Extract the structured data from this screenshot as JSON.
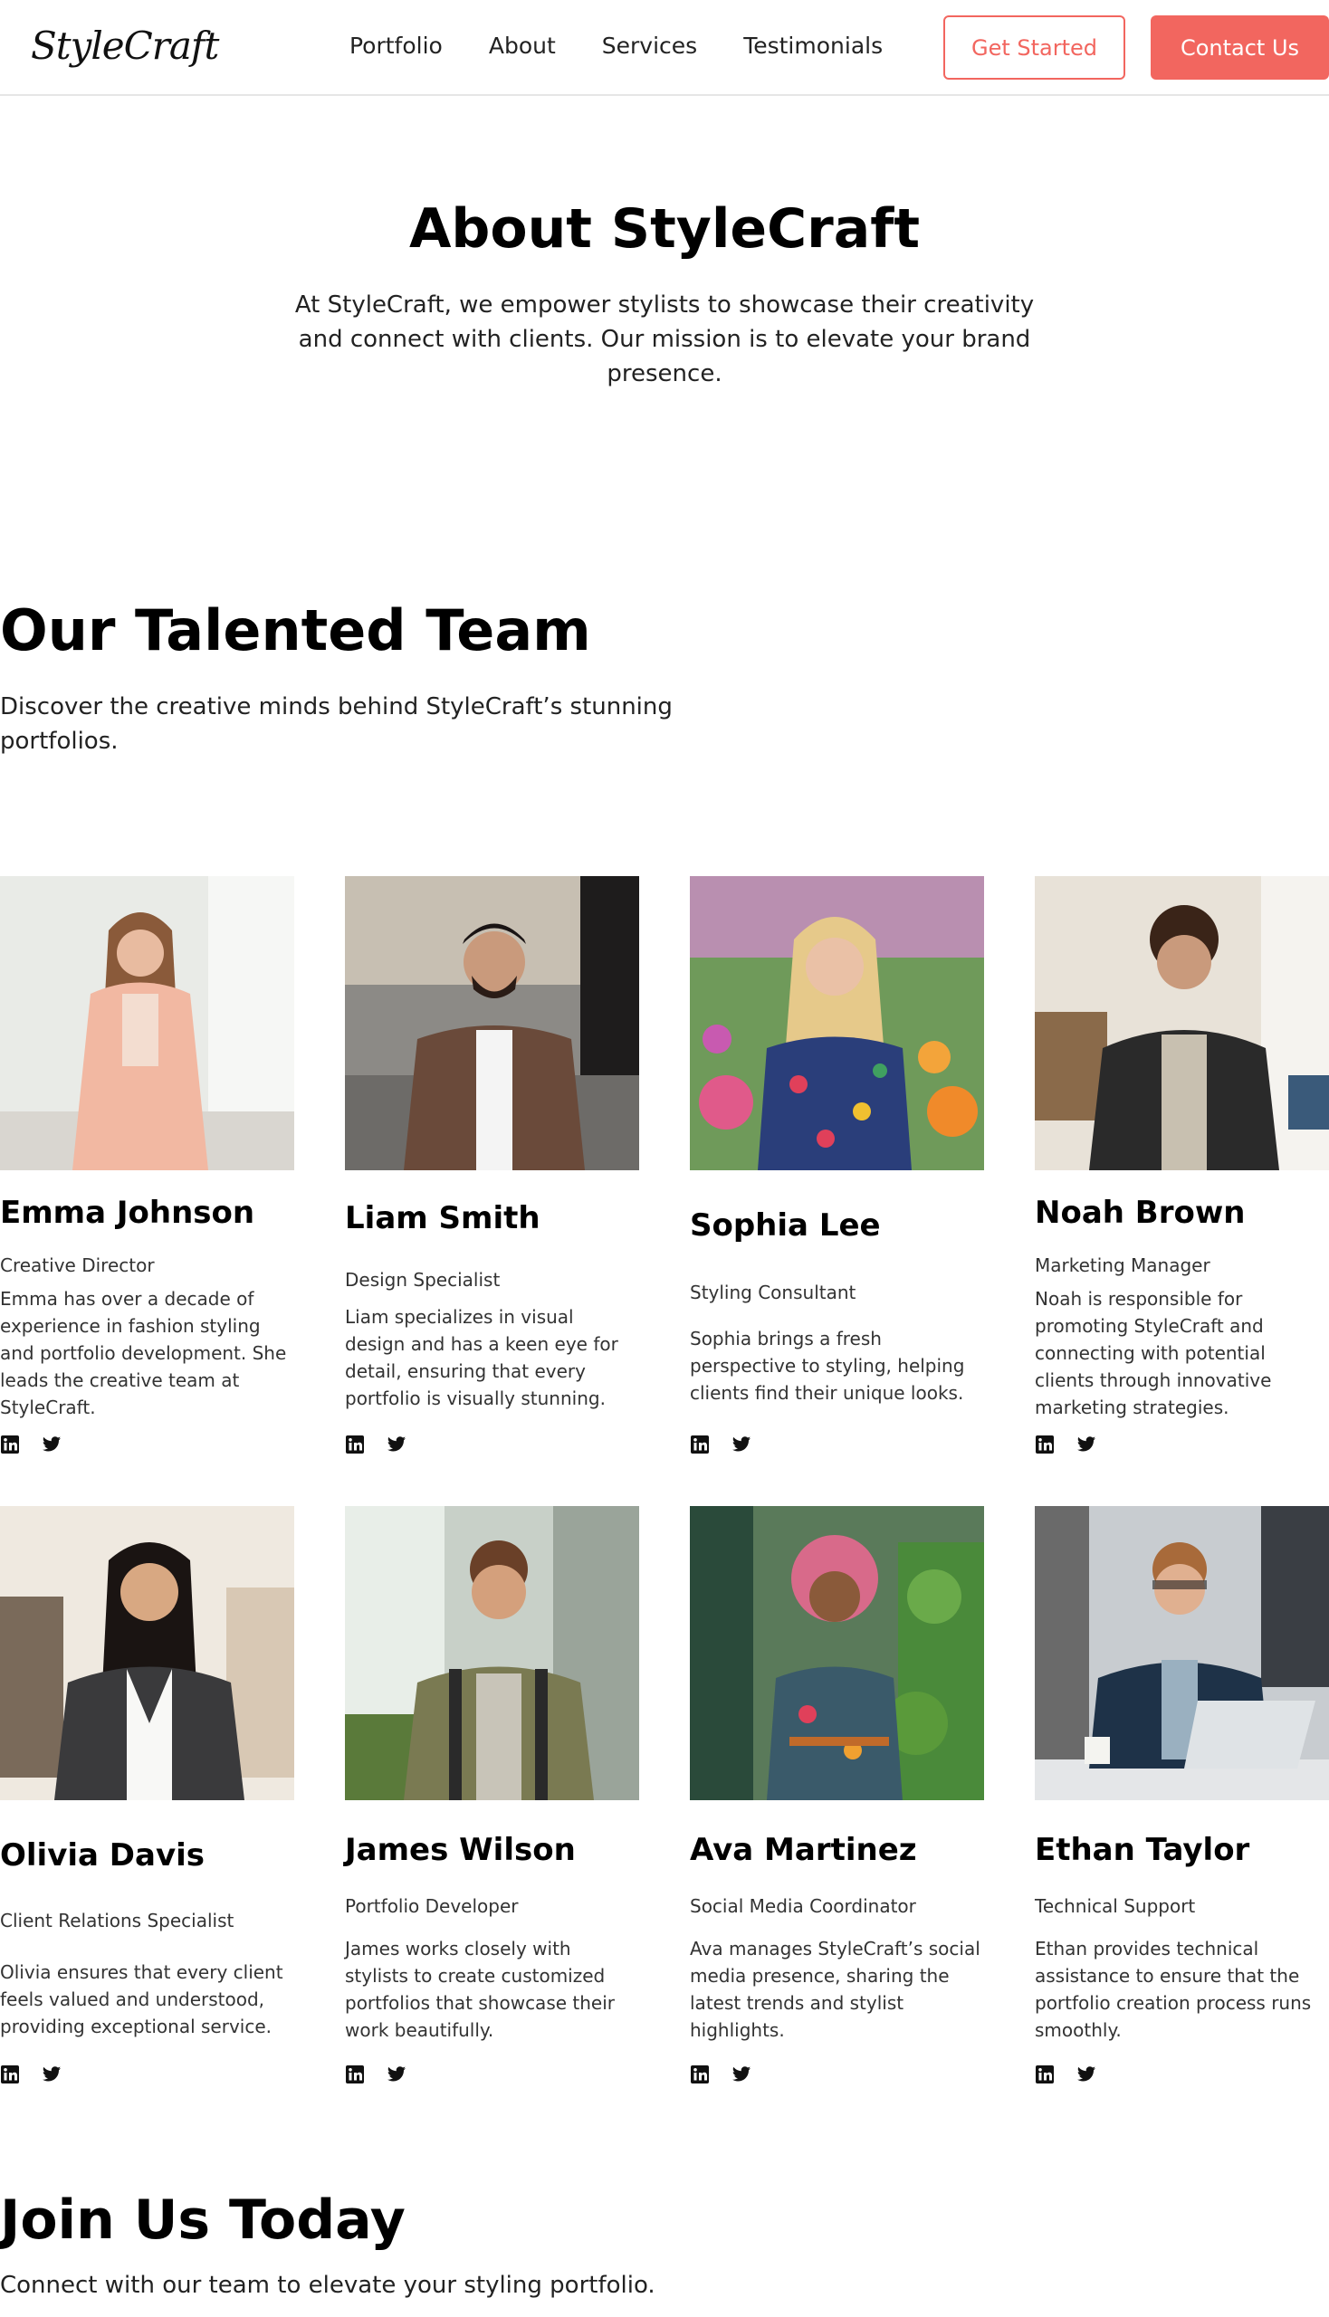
{
  "header": {
    "logo": "StyleCraft",
    "nav": [
      "Portfolio",
      "About",
      "Services",
      "Testimonials"
    ],
    "get_started": "Get Started",
    "contact": "Contact Us"
  },
  "about": {
    "title": "About StyleCraft",
    "text": "At StyleCraft, we empower stylists to showcase their creativity and connect with clients. Our mission is to elevate your brand presence."
  },
  "team": {
    "title": "Our Talented Team",
    "subtitle": "Discover the creative minds behind StyleCraft’s stunning portfolios.",
    "members": [
      {
        "name": "Emma Johnson",
        "role": "Creative Director",
        "bio": "Emma has over a decade of experience in fashion styling and portfolio development. She leads the creative team at StyleCraft.",
        "photo": "woman-blazer-photo"
      },
      {
        "name": "Liam Smith",
        "role": "Design Specialist",
        "bio": "Liam specializes in visual design and has a keen eye for detail, ensuring that every portfolio is visually stunning.",
        "photo": "man-jacket-street-photo"
      },
      {
        "name": "Sophia Lee",
        "role": "Styling Consultant",
        "bio": "Sophia brings a fresh perspective to styling, helping clients find their unique looks.",
        "photo": "woman-floral-garden-photo"
      },
      {
        "name": "Noah Brown",
        "role": "Marketing Manager",
        "bio": "Noah is responsible for promoting StyleCraft and connecting with potential clients through innovative marketing strategies.",
        "photo": "man-curly-office-photo"
      },
      {
        "name": "Olivia Davis",
        "role": "Client Relations Specialist",
        "bio": "Olivia ensures that every client feels valued and understood, providing exceptional service.",
        "photo": "woman-boutique-photo"
      },
      {
        "name": "James Wilson",
        "role": "Portfolio Developer",
        "bio": "James works closely with stylists to create customized portfolios that showcase their work beautifully.",
        "photo": "man-backpack-photo"
      },
      {
        "name": "Ava Martinez",
        "role": "Social Media Coordinator",
        "bio": "Ava manages StyleCraft’s social media presence, sharing the latest trends and stylist highlights.",
        "photo": "woman-curly-plants-photo"
      },
      {
        "name": "Ethan Taylor",
        "role": "Technical Support",
        "bio": "Ethan provides technical assistance to ensure that the portfolio creation process runs smoothly.",
        "photo": "man-laptop-photo"
      }
    ]
  },
  "join": {
    "title": "Join Us Today",
    "subtitle": "Connect with our team to elevate your styling portfolio."
  },
  "colors": {
    "accent": "#f2665f",
    "text": "#111111"
  },
  "icons": [
    "linkedin-icon",
    "twitter-icon"
  ]
}
